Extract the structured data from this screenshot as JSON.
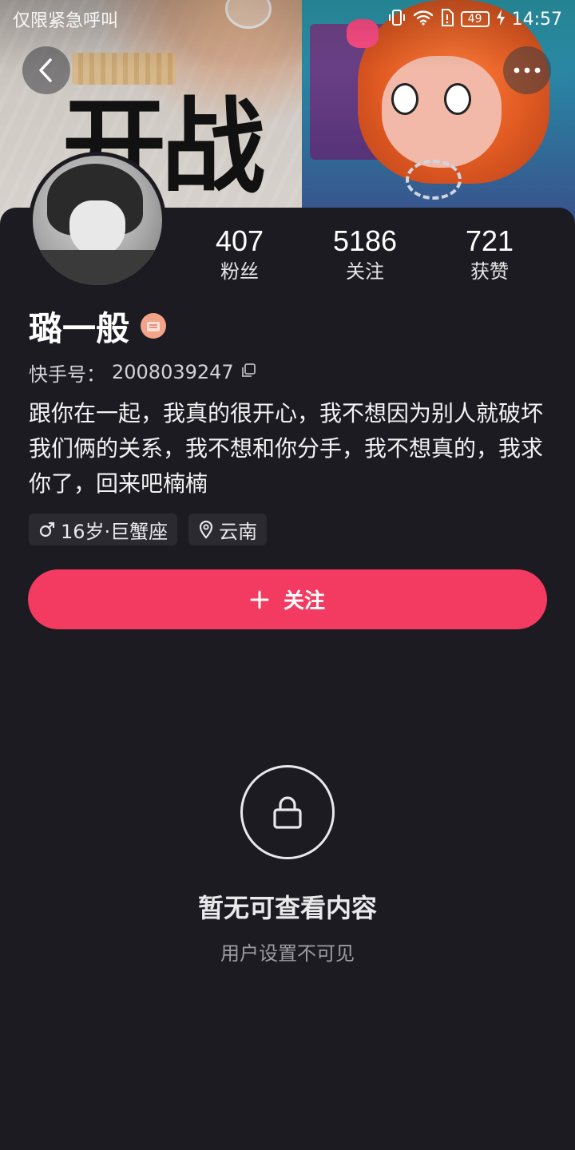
{
  "status_bar": {
    "carrier_text": "仅限紧急呼叫",
    "battery": "49",
    "time": "14:57"
  },
  "banner": {
    "left_text": "开战"
  },
  "profile": {
    "stats": [
      {
        "value": "407",
        "label": "粉丝"
      },
      {
        "value": "5186",
        "label": "关注"
      },
      {
        "value": "721",
        "label": "获赞"
      }
    ],
    "name": "璐一般",
    "kwai_id_label": "快手号：",
    "kwai_id": "2008039247",
    "bio": "跟你在一起，我真的很开心，我不想因为别人就破坏我们俩的关系，我不想和你分手，我不想真的，我求你了，回来吧楠楠",
    "tags": {
      "age_constellation": "16岁·巨蟹座",
      "location": "云南"
    },
    "follow_label": "关注"
  },
  "empty_state": {
    "title": "暂无可查看内容",
    "subtitle": "用户设置不可见"
  },
  "colors": {
    "background": "#1c1b21",
    "accent": "#f33a61",
    "tag_bg": "#2b2a31"
  }
}
